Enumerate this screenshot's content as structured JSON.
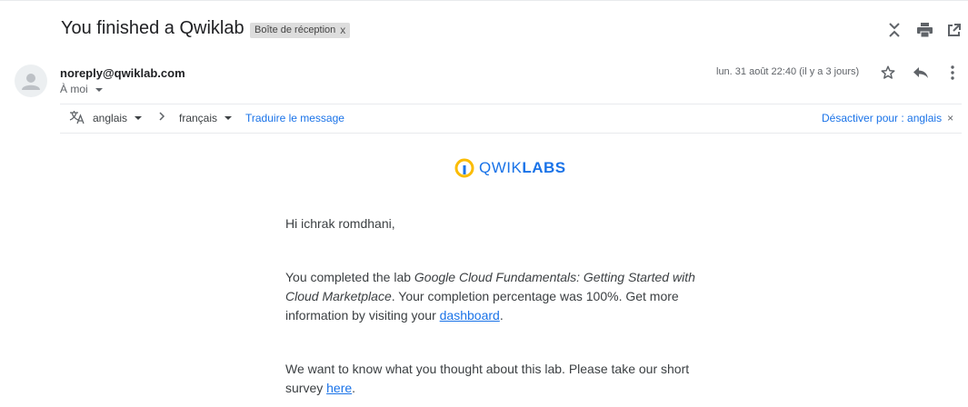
{
  "header": {
    "subject": "You finished a Qwiklab",
    "label": "Boîte de réception",
    "label_close": "x"
  },
  "sender": {
    "email": "noreply@qwiklab.com",
    "to": "À moi",
    "date": "lun. 31 août 22:40 (il y a 3 jours)"
  },
  "translate": {
    "from_lang": "anglais",
    "to_lang": "français",
    "translate_link": "Traduire le message",
    "disable_link": "Désactiver pour : anglais",
    "disable_close": "×"
  },
  "email": {
    "logo_light": "QWIK",
    "logo_bold": "LABS",
    "greeting": "Hi ichrak romdhani,",
    "p1_start": "You completed the lab ",
    "p1_lab": "Google Cloud Fundamentals: Getting Started with Cloud Marketplace",
    "p1_mid": ". Your completion percentage was 100%. Get more information by visiting your ",
    "p1_link": "dashboard",
    "p1_end": ".",
    "p2_start": "We want to know what you thought about this lab. Please take our short survey ",
    "p2_link": "here",
    "p2_end": "."
  },
  "colors": {
    "accent": "#1a73e8",
    "logo_yellow": "#fbbc04"
  },
  "icons": [
    "expand-collapse-icon",
    "print-icon",
    "open-new-window-icon",
    "star-icon",
    "reply-icon",
    "more-vert-icon",
    "translate-icon",
    "avatar-person-icon"
  ]
}
